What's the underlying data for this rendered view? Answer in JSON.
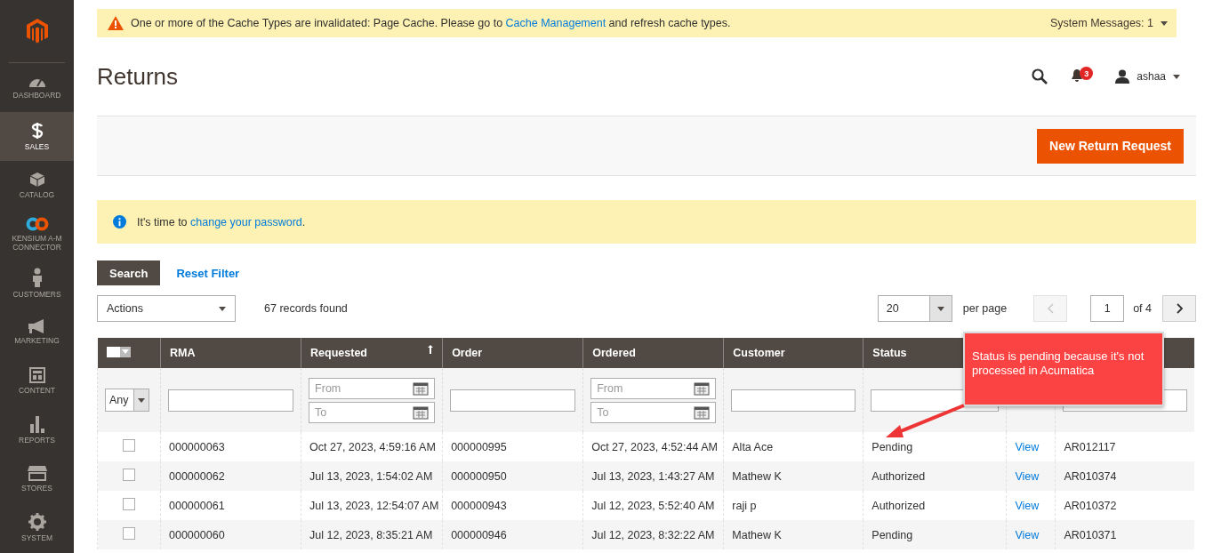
{
  "sidebar": {
    "items": [
      {
        "label": "DASHBOARD",
        "selected": false
      },
      {
        "label": "SALES",
        "selected": true
      },
      {
        "label": "CATALOG",
        "selected": false
      },
      {
        "label": "KENSIUM A-M CONNECTOR",
        "selected": false
      },
      {
        "label": "CUSTOMERS",
        "selected": false
      },
      {
        "label": "MARKETING",
        "selected": false
      },
      {
        "label": "CONTENT",
        "selected": false
      },
      {
        "label": "REPORTS",
        "selected": false
      },
      {
        "label": "STORES",
        "selected": false
      },
      {
        "label": "SYSTEM",
        "selected": false
      }
    ]
  },
  "system_message": {
    "text": "One or more of the Cache Types are invalidated: Page Cache. Please go to ",
    "link": "Cache Management",
    "text_after": " and refresh cache types.",
    "counter": "System Messages: 1"
  },
  "header": {
    "title": "Returns",
    "notifications": "3",
    "user": "ashaa"
  },
  "action_bar": {
    "button": "New Return Request"
  },
  "notice": {
    "text": "It's time to ",
    "link": "change your password",
    "text_after": "."
  },
  "toolbar": {
    "search": "Search",
    "reset": "Reset Filter",
    "actions": "Actions",
    "records": "67 records found",
    "per_page": "20",
    "per_page_label": "per page",
    "page": "1",
    "page_total": "of 4"
  },
  "table": {
    "select_filter": "Any",
    "columns": [
      {
        "kind": "text",
        "label": "RMA",
        "sorted": false
      },
      {
        "kind": "text",
        "label": "Requested",
        "sorted": true
      },
      {
        "kind": "text",
        "label": "Order",
        "sorted": false
      },
      {
        "kind": "text",
        "label": "Ordered",
        "sorted": false
      },
      {
        "kind": "text",
        "label": "Customer",
        "sorted": false
      },
      {
        "kind": "text",
        "label": "Status",
        "sorted": false
      },
      {
        "kind": "covered"
      },
      {
        "kind": "covered"
      }
    ],
    "filters": [
      {
        "kind": "text"
      },
      {
        "kind": "date-range",
        "from": "From",
        "to": "To"
      },
      {
        "kind": "text"
      },
      {
        "kind": "date-range",
        "from": "From",
        "to": "To"
      },
      {
        "kind": "text"
      },
      {
        "kind": "text"
      },
      {
        "kind": "none"
      },
      {
        "kind": "text"
      }
    ],
    "rows": [
      {
        "checked": false,
        "cells": [
          "000000063",
          "Oct 27, 2023, 4:59:16 AM",
          "000000995",
          "Oct 27, 2023, 4:52:44 AM",
          "Alta Ace",
          "Pending",
          "View",
          "AR012117"
        ]
      },
      {
        "checked": false,
        "cells": [
          "000000062",
          "Jul 13, 2023, 1:54:02 AM",
          "000000950",
          "Jul 13, 2023, 1:43:27 AM",
          "Mathew K",
          "Authorized",
          "View",
          "AR010374"
        ]
      },
      {
        "checked": false,
        "cells": [
          "000000061",
          "Jul 13, 2023, 12:54:07 AM",
          "000000943",
          "Jul 12, 2023, 5:52:40 AM",
          "raji p",
          "Authorized",
          "View",
          "AR010372"
        ]
      },
      {
        "checked": false,
        "cells": [
          "000000060",
          "Jul 12, 2023, 8:35:21 AM",
          "000000946",
          "Jul 12, 2023, 8:32:22 AM",
          "Mathew K",
          "Pending",
          "View",
          "AR010371"
        ]
      }
    ]
  },
  "callout": {
    "text": "Status is pending because it's not processed in Acumatica"
  }
}
